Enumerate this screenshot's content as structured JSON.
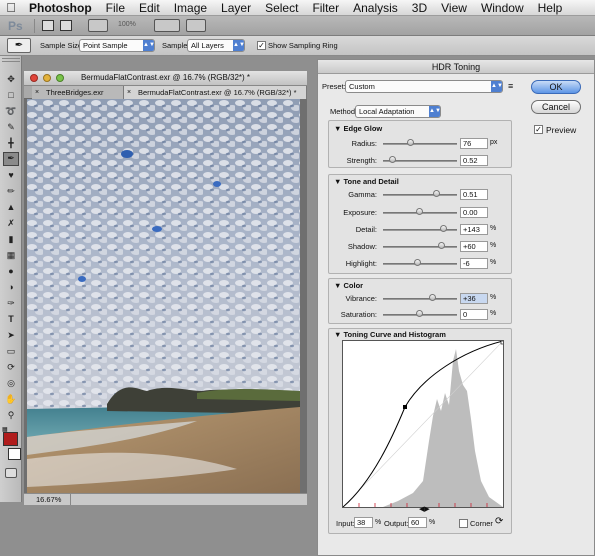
{
  "menubar": {
    "apple": "",
    "app_name": "Photoshop",
    "items": [
      "File",
      "Edit",
      "Image",
      "Layer",
      "Select",
      "Filter",
      "Analysis",
      "3D",
      "View",
      "Window",
      "Help"
    ]
  },
  "app_toolbar": {
    "logo": "Ps",
    "zoom": "100%"
  },
  "options_bar": {
    "sample_size_label": "Sample Size:",
    "sample_size_value": "Point Sample",
    "sample_label": "Sample:",
    "sample_value": "All Layers",
    "sampling_ring_label": "Show Sampling Ring",
    "sampling_ring_checked": true
  },
  "document": {
    "title": "BermudaFlatContrast.exr @ 16.7% (RGB/32*) *",
    "tabs": [
      {
        "label": "ThreeBridges.exr"
      },
      {
        "label": "BermudaFlatContrast.exr @ 16.7% (RGB/32*) *"
      }
    ],
    "zoom": "16.67%"
  },
  "dialog": {
    "title": "HDR Toning",
    "preset_label": "Preset:",
    "preset_value": "Custom",
    "method_label": "Method:",
    "method_value": "Local Adaptation",
    "ok_label": "OK",
    "cancel_label": "Cancel",
    "preview_label": "Preview",
    "preview_checked": true,
    "edge_glow": {
      "title": "Edge Glow",
      "radius": {
        "label": "Radius:",
        "value": "76",
        "unit": "px",
        "level": 0.38
      },
      "strength": {
        "label": "Strength:",
        "value": "0.52",
        "level": 0.13
      }
    },
    "tone_detail": {
      "title": "Tone and Detail",
      "gamma": {
        "label": "Gamma:",
        "value": "0.51",
        "level": 0.73
      },
      "exposure": {
        "label": "Exposure:",
        "value": "0.00",
        "level": 0.5
      },
      "detail": {
        "label": "Detail:",
        "value": "+143",
        "unit": "%",
        "level": 0.83
      },
      "shadow": {
        "label": "Shadow:",
        "value": "+60",
        "unit": "%",
        "level": 0.8
      },
      "highlight": {
        "label": "Highlight:",
        "value": "-6",
        "unit": "%",
        "level": 0.47
      }
    },
    "color": {
      "title": "Color",
      "vibrance": {
        "label": "Vibrance:",
        "value": "+36",
        "unit": "%",
        "level": 0.68
      },
      "saturation": {
        "label": "Saturation:",
        "value": "0",
        "unit": "%",
        "level": 0.5
      }
    },
    "curve": {
      "title": "Toning Curve and Histogram",
      "input_label": "Input:",
      "input_value": "38",
      "input_unit": "%",
      "output_label": "Output:",
      "output_value": "60",
      "output_unit": "%",
      "corner_label": "Corner"
    }
  }
}
